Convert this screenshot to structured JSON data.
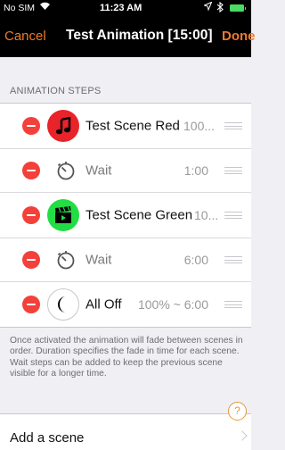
{
  "status_bar": {
    "carrier": "No SIM",
    "wifi_icon": "wifi-icon",
    "time": "11:23 AM",
    "location_icon": "location-arrow-icon",
    "bluetooth_icon": "bluetooth-icon",
    "battery_color": "#4cd964"
  },
  "nav": {
    "cancel": "Cancel",
    "title": "Test Animation [15:00]",
    "done": "Done",
    "accent_color": "#f07a2a"
  },
  "section": {
    "header": "ANIMATION STEPS"
  },
  "steps": [
    {
      "kind": "scene",
      "icon": "music-note-icon",
      "icon_color": "#e8232a",
      "label": "Test Scene Red",
      "value": "100..."
    },
    {
      "kind": "wait",
      "icon": "timer-icon",
      "label": "Wait",
      "value": "1:00"
    },
    {
      "kind": "scene",
      "icon": "clapperboard-icon",
      "icon_color": "#22dd44",
      "label": "Test Scene Green",
      "value": "10..."
    },
    {
      "kind": "wait",
      "icon": "timer-icon",
      "label": "Wait",
      "value": "6:00"
    },
    {
      "kind": "scene",
      "icon": "moon-icon",
      "icon_color": "#ffffff",
      "label": "All Off",
      "value": "100% ~ 6:00"
    }
  ],
  "footer": {
    "description": "Once activated the animation will fade between scenes in order. Duration specifies the fade in time for each scene. Wait steps can be added to keep the previous scene visible for a longer time."
  },
  "add": {
    "label": "Add a scene",
    "help": "?"
  }
}
